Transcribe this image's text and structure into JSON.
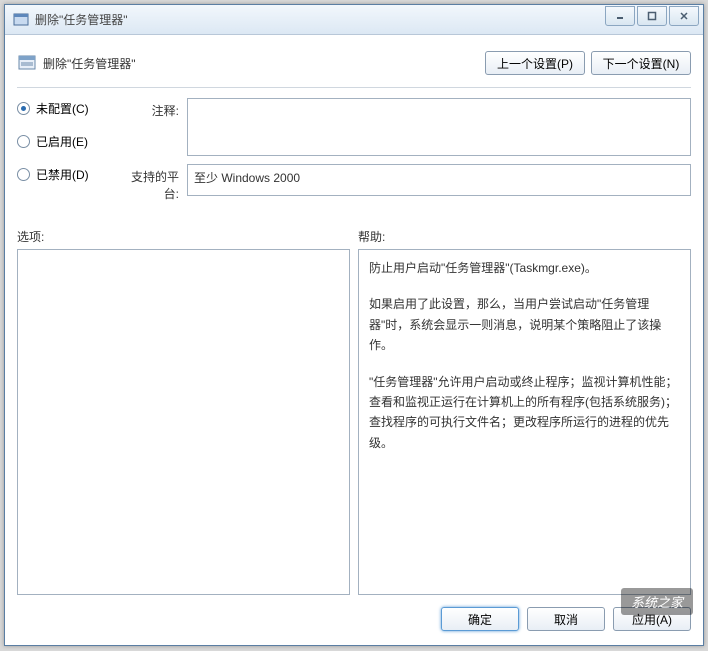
{
  "titlebar": {
    "text": "删除\"任务管理器\""
  },
  "header": {
    "title": "删除\"任务管理器\""
  },
  "nav": {
    "prev": "上一个设置(P)",
    "next": "下一个设置(N)"
  },
  "radios": {
    "not_configured": "未配置(C)",
    "enabled": "已启用(E)",
    "disabled": "已禁用(D)"
  },
  "fields": {
    "comment_label": "注释:",
    "comment_value": "",
    "platform_label": "支持的平台:",
    "platform_value": "至少 Windows 2000"
  },
  "sections": {
    "options_label": "选项:",
    "help_label": "帮助:"
  },
  "help": {
    "p1": "防止用户启动\"任务管理器\"(Taskmgr.exe)。",
    "p2": "如果启用了此设置，那么，当用户尝试启动\"任务管理器\"时，系统会显示一则消息，说明某个策略阻止了该操作。",
    "p3": "\"任务管理器\"允许用户启动或终止程序；监视计算机性能；查看和监视正运行在计算机上的所有程序(包括系统服务)；查找程序的可执行文件名；更改程序所运行的进程的优先级。"
  },
  "buttons": {
    "ok": "确定",
    "cancel": "取消",
    "apply": "应用(A)"
  },
  "watermark": "系统之家"
}
